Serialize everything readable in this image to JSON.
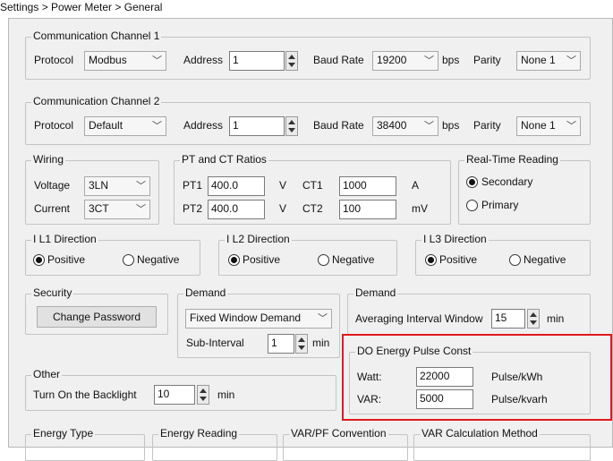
{
  "breadcrumb": "Settings > Power Meter > General",
  "comm1": {
    "title": "Communication Channel 1",
    "protocol_label": "Protocol",
    "protocol": "Modbus",
    "address_label": "Address",
    "address": "1",
    "baud_label": "Baud Rate",
    "baud": "19200",
    "bps": "bps",
    "parity_label": "Parity",
    "parity": "None 1"
  },
  "comm2": {
    "title": "Communication Channel 2",
    "protocol_label": "Protocol",
    "protocol": "Default",
    "address_label": "Address",
    "address": "1",
    "baud_label": "Baud Rate",
    "baud": "38400",
    "bps": "bps",
    "parity_label": "Parity",
    "parity": "None 1"
  },
  "wiring": {
    "title": "Wiring",
    "voltage_label": "Voltage",
    "voltage": "3LN",
    "current_label": "Current",
    "current": "3CT"
  },
  "ratios": {
    "title": "PT and CT Ratios",
    "pt1_label": "PT1",
    "pt1": "400.0",
    "pt1_unit": "V",
    "ct1_label": "CT1",
    "ct1": "1000",
    "ct1_unit": "A",
    "pt2_label": "PT2",
    "pt2": "400.0",
    "pt2_unit": "V",
    "ct2_label": "CT2",
    "ct2": "100",
    "ct2_unit": "mV"
  },
  "realtime": {
    "title": "Real-Time Reading",
    "secondary": "Secondary",
    "primary": "Primary"
  },
  "il1": {
    "title": "I L1 Direction",
    "positive": "Positive",
    "negative": "Negative"
  },
  "il2": {
    "title": "I L2 Direction",
    "positive": "Positive",
    "negative": "Negative"
  },
  "il3": {
    "title": "I L3 Direction",
    "positive": "Positive",
    "negative": "Negative"
  },
  "security": {
    "title": "Security",
    "button": "Change Password"
  },
  "demand1": {
    "title": "Demand",
    "mode": "Fixed Window Demand",
    "sub_label": "Sub-Interval",
    "sub_value": "1",
    "sub_unit": "min"
  },
  "demand2": {
    "title": "Demand",
    "avg_label": "Averaging Interval Window",
    "avg_value": "15",
    "avg_unit": "min"
  },
  "pulse": {
    "title": "DO Energy Pulse Const",
    "watt_label": "Watt:",
    "watt": "22000",
    "watt_unit": "Pulse/kWh",
    "var_label": "VAR:",
    "var": "5000",
    "var_unit": "Pulse/kvarh"
  },
  "other": {
    "title": "Other",
    "backlight_label": "Turn On the Backlight",
    "backlight": "10",
    "backlight_unit": "min"
  },
  "bottom": {
    "energy_type": "Energy Type",
    "energy_reading": "Energy Reading",
    "varpf": "VAR/PF Convention",
    "var_calc": "VAR Calculation Method"
  }
}
